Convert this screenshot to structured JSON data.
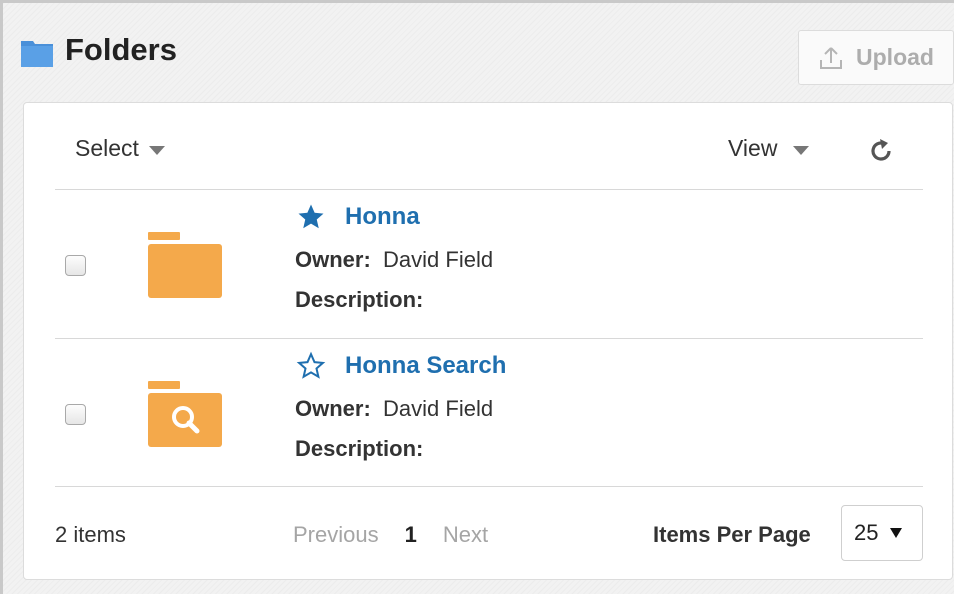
{
  "header": {
    "title": "Folders",
    "title_icon": "folder-icon",
    "upload_label": "Upload",
    "upload_icon": "upload-icon"
  },
  "toolbar": {
    "select_label": "Select",
    "view_label": "View",
    "refresh_icon": "refresh-icon"
  },
  "items": [
    {
      "name": "Honna",
      "favorite": true,
      "icon": "folder-icon",
      "owner_label": "Owner:",
      "owner": "David Field",
      "description_label": "Description:",
      "description": ""
    },
    {
      "name": "Honna Search",
      "favorite": false,
      "icon": "search-folder-icon",
      "owner_label": "Owner:",
      "owner": "David Field",
      "description_label": "Description:",
      "description": ""
    }
  ],
  "footer": {
    "count_label": "2 items",
    "previous_label": "Previous",
    "current_page": "1",
    "next_label": "Next",
    "items_per_page_label": "Items Per Page",
    "items_per_page_value": "25"
  },
  "colors": {
    "accent": "#1f6faf",
    "folder": "#f4a94b",
    "title_icon": "#4a90d9"
  }
}
